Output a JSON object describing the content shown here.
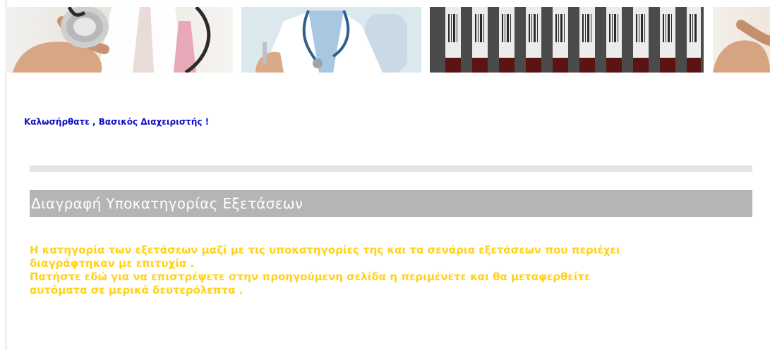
{
  "welcome": "Καλωσήρθατε , Βασικός Διαχειριστής !",
  "page_title": "Διαγραφή Υποκατηγορίας Εξετάσεων",
  "message": {
    "line1": "Η κατηγορία των εξετάσεων μαζί με τις υποκατηγορίες της και τα σενάρια εξετάσεων που περιέχει",
    "line2": "διαγράφτηκαν με επιτυχία .",
    "link_text": "Πατήστε εδώ",
    "line3_rest": " για να επιστρέψετε στην προηγούμενη σελίδα η περιμένετε και θα μεταφερθείτε",
    "line4": "αυτόματα σε μερικά δευτερόλεπτα ."
  },
  "colors": {
    "welcome": "#1010c8",
    "message": "#ffd21a",
    "title_bar": "#b5b5b5",
    "divider": "#e3e3e3"
  }
}
